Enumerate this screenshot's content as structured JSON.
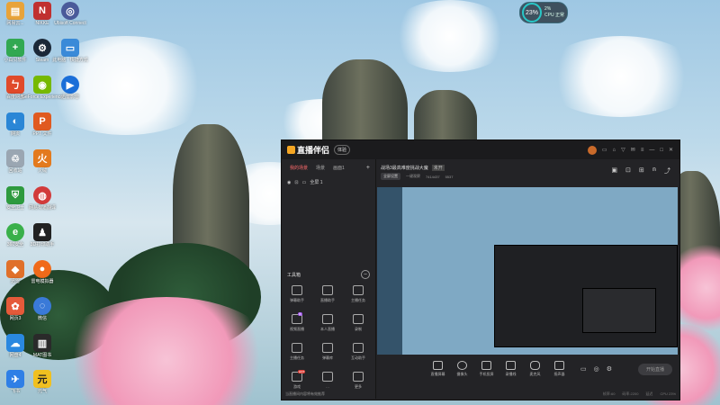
{
  "desktop": {
    "icons": [
      {
        "label": "网易云...",
        "icon": "folder-icon",
        "color": "#e8a33a"
      },
      {
        "label": "NIKKE",
        "icon": "nikke-icon",
        "color": "#c03030"
      },
      {
        "label": "Ubisoft Connect",
        "icon": "ubisoft-icon",
        "color": "#4a5a9a"
      },
      {
        "label": "小白贝软件",
        "icon": "plus-icon",
        "color": "#32a852"
      },
      {
        "label": "Steam",
        "icon": "steam-icon",
        "color": "#1b2838"
      },
      {
        "label": "此电脑 · 快捷方式",
        "icon": "computer-icon",
        "color": "#3a8ad8"
      },
      {
        "label": "百度网盘",
        "icon": "qq-game-icon",
        "color": "#e04a2a"
      },
      {
        "label": "GeForce Experience",
        "icon": "nvidia-icon",
        "color": "#76b900"
      },
      {
        "label": "迅雷影音",
        "icon": "video-icon",
        "color": "#1a6ed8"
      },
      {
        "label": "网页",
        "icon": "browser-icon",
        "color": "#2a86d6"
      },
      {
        "label": "PPT 文件",
        "icon": "ppt-icon",
        "color": "#e05a20"
      },
      {
        "label": "回收站",
        "icon": "recycle-bin-icon",
        "color": "#9aa6b2"
      },
      {
        "label": "火绒",
        "icon": "fire-icon",
        "color": "#e37a1e"
      },
      {
        "label": "安全卫士",
        "icon": "shield-icon",
        "color": "#2e9a3e"
      },
      {
        "label": "网易有道翻译",
        "icon": "globe-icon",
        "color": "#d23a3a"
      },
      {
        "label": "3D打印助手",
        "icon": "penguin-icon",
        "color": "#222222"
      },
      {
        "label": "360安全",
        "icon": "green-e-icon",
        "color": "#3ab04a"
      },
      {
        "label": "迅雷",
        "icon": "bird-icon",
        "color": "#e0702a"
      },
      {
        "label": "雷电模拟器",
        "icon": "ball-icon",
        "color": "#f06a1a"
      },
      {
        "label": "网页3",
        "icon": "bee-icon",
        "color": "#e55a3a"
      },
      {
        "label": "微信",
        "icon": "chat-icon",
        "color": "#3a7ad8"
      },
      {
        "label": "网盘4",
        "icon": "cloud-icon",
        "color": "#2a88e0"
      },
      {
        "label": "MAT图书",
        "icon": "books-icon",
        "color": "#2a2a2a"
      },
      {
        "label": "飞书",
        "icon": "send-icon",
        "color": "#2f7fe6"
      },
      {
        "label": "元气",
        "icon": "yuan-icon",
        "color": "#f0c020"
      }
    ]
  },
  "cpu_widget": {
    "percent": "23%",
    "line1": "2%",
    "line2": "CPU 正常"
  },
  "app": {
    "name": "直播伴侣",
    "vip_label": "体验",
    "tabs": [
      "我的场景",
      "场景",
      "画面1"
    ],
    "add_tab": "+",
    "scene_label": "全屏 1",
    "tools_title": "工具箱",
    "tools": [
      {
        "label": "弹幕助手",
        "badge": ""
      },
      {
        "label": "直播助手",
        "badge": ""
      },
      {
        "label": "主播任务",
        "badge": ""
      },
      {
        "label": "视频直播",
        "badge": "新"
      },
      {
        "label": "本人直播",
        "badge": ""
      },
      {
        "label": "录制",
        "badge": ""
      },
      {
        "label": "主播任务",
        "badge": ""
      },
      {
        "label": "弹幕库",
        "badge": ""
      },
      {
        "label": "互动助手",
        "badge": ""
      },
      {
        "label": "游戏",
        "badge": "HOT"
      },
      {
        "label": "…",
        "badge": ""
      },
      {
        "label": "更多",
        "badge": ""
      }
    ],
    "left_footer": "当直播间内容将有效推荐",
    "room_title": "战场3最高难度挑战大魔",
    "room_tag": "未开",
    "stats": [
      "全屏设置",
      "一键观察",
      "7414437",
      "5537"
    ],
    "controls": [
      "直播屏幕",
      "摄像头",
      "手机投屏",
      "录播线",
      "麦克风",
      "扬声器"
    ],
    "start_label": "开始直播",
    "status_items": [
      "帧率:60",
      "码率:2200",
      "延迟",
      "CPU 23%"
    ]
  }
}
